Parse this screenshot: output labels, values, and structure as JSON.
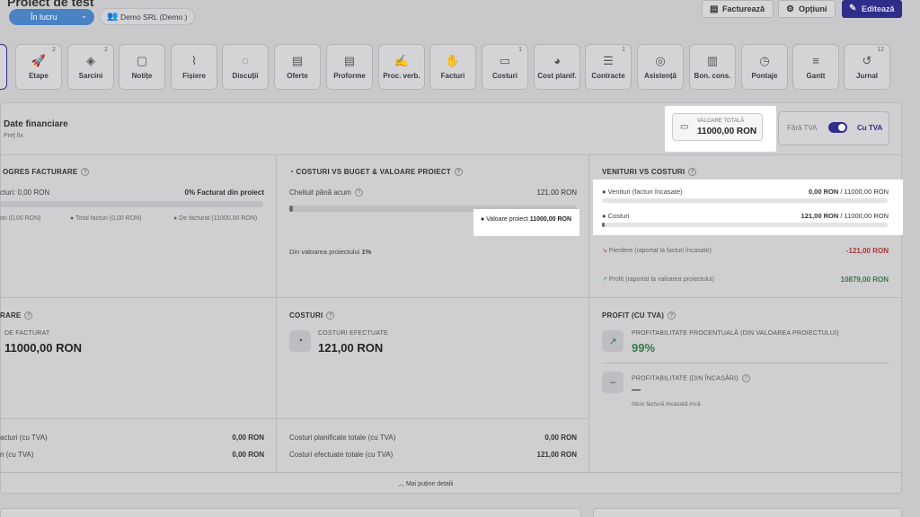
{
  "header": {
    "project_title": "Proiect de test",
    "status": "În lucru",
    "client": "Demo SRL (Demo )",
    "btn_invoice": "Facturează",
    "btn_options": "Opțiuni",
    "btn_edit": "Editează"
  },
  "tabs": [
    {
      "label": "Etape",
      "count": "2",
      "icon": "rocket-icon"
    },
    {
      "label": "Sarcini",
      "count": "2",
      "icon": "layers-icon"
    },
    {
      "label": "Notițe",
      "count": "",
      "icon": "note-icon"
    },
    {
      "label": "Fișiere",
      "count": "",
      "icon": "paperclip-icon"
    },
    {
      "label": "Discuții",
      "count": "",
      "icon": "chat-icon"
    },
    {
      "label": "Oferte",
      "count": "",
      "icon": "document-icon"
    },
    {
      "label": "Proforme",
      "count": "",
      "icon": "document-icon"
    },
    {
      "label": "Proc. verb.",
      "count": "",
      "icon": "signed-doc-icon"
    },
    {
      "label": "Facturi",
      "count": "",
      "icon": "hand-money-icon"
    },
    {
      "label": "Costuri",
      "count": "1",
      "icon": "banknote-icon"
    },
    {
      "label": "Cost planif.",
      "count": "",
      "icon": "piggy-bank-icon"
    },
    {
      "label": "Contracte",
      "count": "1",
      "icon": "contract-icon"
    },
    {
      "label": "Asistență",
      "count": "",
      "icon": "lifebuoy-icon"
    },
    {
      "label": "Bon. cons.",
      "count": "",
      "icon": "receipt-icon"
    },
    {
      "label": "Pontaje",
      "count": "",
      "icon": "clock-icon"
    },
    {
      "label": "Gantt",
      "count": "",
      "icon": "gantt-icon"
    },
    {
      "label": "Jurnal",
      "count": "12",
      "icon": "history-icon"
    }
  ],
  "financial": {
    "title": "Date financiare",
    "subtitle": "Preț fix",
    "total_label": "VALOARE TOTALĂ",
    "total_value": "11000,00 RON",
    "vat_off": "Fără TVA",
    "vat_on": "Cu TVA",
    "vat_enabled": true
  },
  "progress_billing": {
    "title": "OGRES FACTURARE",
    "invoiced_label": "cturi: 0,00 RON",
    "invoiced_pct": "0% Facturat din proiect",
    "invoiced_fraction": 0,
    "legend_1": "ori (0,00 RON)",
    "legend_2": "Total facturi (0,00 RON)",
    "legend_3": "De facturat (11000,00 RON)"
  },
  "cost_vs_budget": {
    "title": "COSTURI VS BUGET & VALOARE PROIECT",
    "spent_label": "Cheltuit până acum",
    "spent_value": "121,00 RON",
    "spent_fraction": 0.011,
    "marker_label": "Valoare proiect",
    "marker_value": "11000,00 RON",
    "pct_label": "Din valoarea proiectului",
    "pct_value": "1%"
  },
  "revenue_vs_costs": {
    "title": "VENITURI VS COSTURI",
    "revenue_label": "Venituri (facturi încasate)",
    "revenue_value": "0,00 RON",
    "revenue_total": "/ 11000,00 RON",
    "revenue_fraction": 0,
    "costs_label": "Costuri",
    "costs_value": "121,00 RON",
    "costs_total": "/ 11000,00 RON",
    "costs_fraction": 0.011,
    "loss_label": "Pierdere (raportat la facturi încasate)",
    "loss_value": "-121,00 RON",
    "profit_label": "Profit (raportat la valoarea proiectului)",
    "profit_value": "10879,00 RON"
  },
  "billing_section": {
    "title": "RARE",
    "due_label": "DE FACTURAT",
    "due_value": "11000,00 RON",
    "row1_label": "acturi (cu TVA)",
    "row1_value": "0,00 RON",
    "row2_label": "n (cu TVA)",
    "row2_value": "0,00 RON"
  },
  "costs_section": {
    "title": "COSTURI",
    "done_label": "COSTURI EFECTUATE",
    "done_value": "121,00 RON",
    "row1_label": "Costuri planificate totale (cu TVA)",
    "row1_value": "0,00 RON",
    "row2_label": "Costuri efectuate totale (cu TVA)",
    "row2_value": "121,00 RON"
  },
  "profit_section": {
    "title": "PROFIT (CU TVA)",
    "pct_label": "PROFITABILITATE PROCENTUALĂ (DIN VALOAREA PROIECTULUI)",
    "pct_value": "99%",
    "cash_label": "PROFITABILITATE (DIN ÎNCASĂRI)",
    "cash_value": "—",
    "cash_note": "Nicio factură încasată încă"
  },
  "footer": {
    "less_details": "Mai puține detalii"
  }
}
